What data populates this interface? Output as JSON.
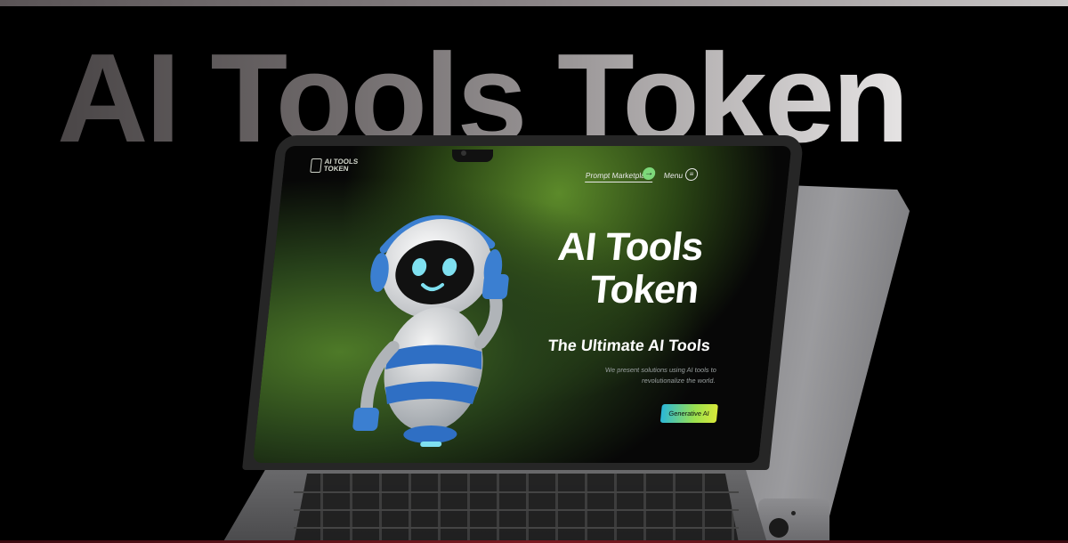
{
  "banner": {
    "title": "AI Tools Token"
  },
  "site": {
    "logo_line1": "AI TOOLS",
    "logo_line2": "TOKEN",
    "nav": {
      "prompt_marketplace": "Prompt Marketplace",
      "arrow_glyph": "→",
      "menu": "Menu",
      "menu_glyph": "≡"
    },
    "hero": {
      "title_line1": "AI Tools",
      "title_line2": "Token",
      "subtitle": "The Ultimate AI Tools",
      "desc_line1": "We present solutions using AI tools to",
      "desc_line2": "revolutionalize the world.",
      "cta": "Generative AI"
    }
  },
  "colors": {
    "accent_green": "#7dd87a",
    "cta_gradient_start": "#2ab7d9",
    "cta_gradient_end": "#d8e83a",
    "robot_blue": "#3b7fd1"
  }
}
